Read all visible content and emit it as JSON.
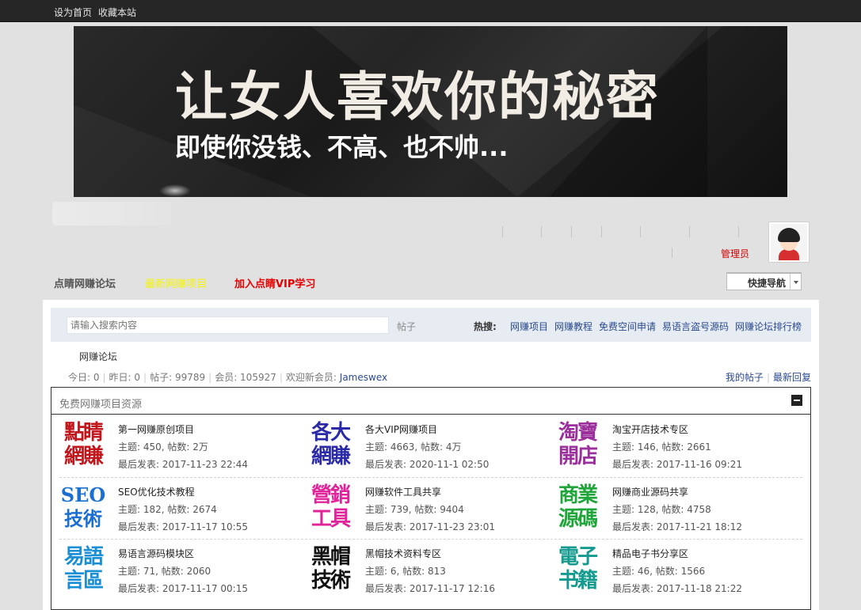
{
  "topbar": {
    "set_home": "设为首页",
    "bookmark": "收藏本站"
  },
  "banner": {
    "title": "让女人喜欢你的秘密",
    "subtitle": "即使你没钱、不高、也不帅..."
  },
  "user": {
    "role": "管理员"
  },
  "subnav": {
    "site_name": "点睛网赚论坛",
    "item2": "最新网赚项目",
    "item3": "加入点睛VIP学习"
  },
  "quicknav": {
    "label": "快捷导航"
  },
  "search": {
    "placeholder": "请输入搜索内容",
    "type": "帖子",
    "hot_label": "热搜:",
    "hot": [
      "网赚项目",
      "网赚教程",
      "免费空间申请",
      "易语言盗号源码",
      "网赚论坛排行榜"
    ]
  },
  "breadcrumb": "网赚论坛",
  "stats": {
    "today": "今日: 0",
    "yesterday": "昨日: 0",
    "posts": "帖子: 99789",
    "members": "会员: 105927",
    "welcome": "欢迎新会员:",
    "newest": "Jameswex"
  },
  "links": {
    "my_posts": "我的帖子",
    "latest_replies": "最新回复"
  },
  "category": {
    "title": "免费网赚项目资源"
  },
  "forums": [
    {
      "logo1": "點睛",
      "logo2": "網賺",
      "color1": "#c0161c",
      "color2": "#c0161c",
      "name": "第一网赚原创项目",
      "meta": "主题: 450, 帖数: 2万",
      "last": "最后发表: 2017-11-23 22:44"
    },
    {
      "logo1": "各大",
      "logo2": "網賺",
      "color1": "#2a2aa8",
      "color2": "#2a2aa8",
      "name": "各大VIP网赚项目",
      "meta": "主题: 4663, 帖数: 4万",
      "last": "最后发表: 2020-11-1 02:50"
    },
    {
      "logo1": "淘寶",
      "logo2": "開店",
      "color1": "#9b2f9b",
      "color2": "#9b2f9b",
      "name": "淘宝开店技术专区",
      "meta": "主题: 146, 帖数: 2661",
      "last": "最后发表: 2017-11-16 09:21"
    },
    {
      "logo1": "SEO",
      "logo2": "技術",
      "color1": "#1b6fd0",
      "color2": "#1b6fd0",
      "name": "SEO优化技术教程",
      "meta": "主题: 182, 帖数: 2674",
      "last": "最后发表: 2017-11-17 10:55"
    },
    {
      "logo1": "營銷",
      "logo2": "工具",
      "color1": "#e0239a",
      "color2": "#e0239a",
      "name": "网赚软件工具共享",
      "meta": "主题: 739, 帖数: 9404",
      "last": "最后发表: 2017-11-23 23:01"
    },
    {
      "logo1": "商業",
      "logo2": "源碼",
      "color1": "#1fa53a",
      "color2": "#1fa53a",
      "name": "网赚商业源码共享",
      "meta": "主题: 128, 帖数: 4758",
      "last": "最后发表: 2017-11-21 18:12"
    },
    {
      "logo1": "易語",
      "logo2": "言區",
      "color1": "#1a8fd6",
      "color2": "#1a8fd6",
      "name": "易语言源码模块区",
      "meta": "主题: 71, 帖数: 2060",
      "last": "最后发表: 2017-11-17 00:15"
    },
    {
      "logo1": "黑帽",
      "logo2": "技術",
      "color1": "#111111",
      "color2": "#111111",
      "name": "黑帽技术资料专区",
      "meta": "主题: 6, 帖数: 813",
      "last": "最后发表: 2017-11-17 12:16"
    },
    {
      "logo1": "電子",
      "logo2": "书籍",
      "color1": "#149a8e",
      "color2": "#149a8e",
      "name": "精品电子书分享区",
      "meta": "主题: 46, 帖数: 1566",
      "last": "最后发表: 2017-11-18 21:22"
    }
  ],
  "colors": {
    "topbar": "#262626",
    "link": "#2a4a8f",
    "admin": "#d10000",
    "vip": "#e60000",
    "new": "#f5f500"
  }
}
